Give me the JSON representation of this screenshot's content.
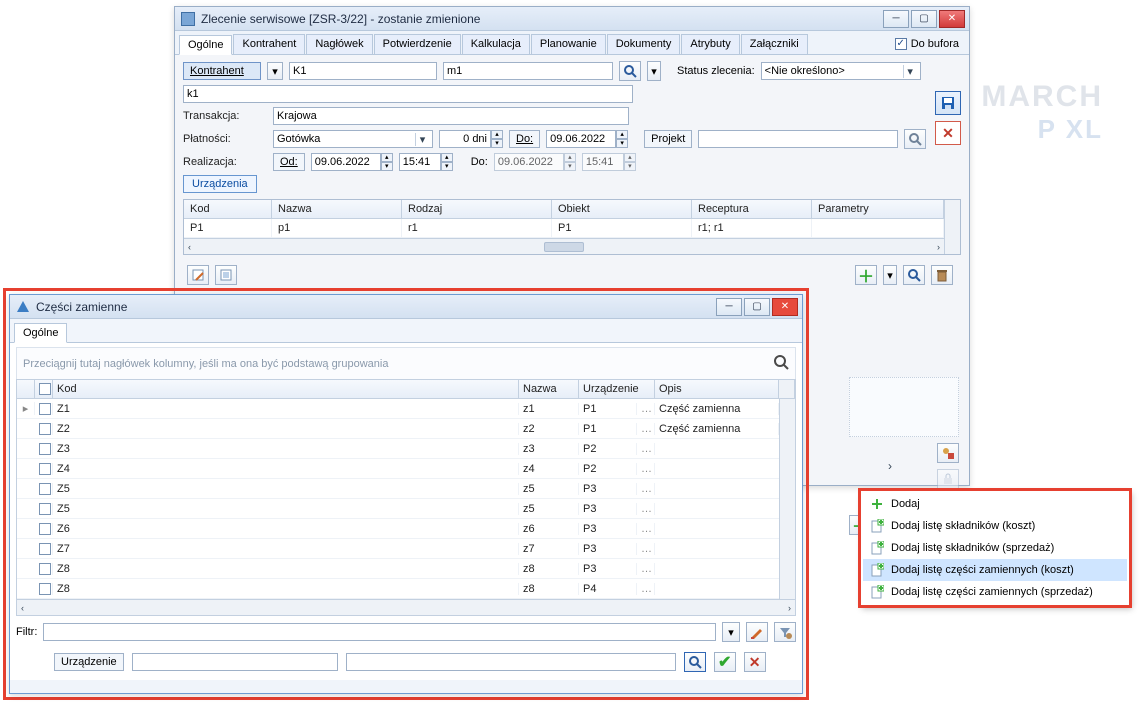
{
  "brand": {
    "l1": "MARCH",
    "l2": "P XL"
  },
  "mainWindow": {
    "title": "Zlecenie serwisowe [ZSR-3/22]  - zostanie zmienione",
    "tabs": [
      "Ogólne",
      "Kontrahent",
      "Nagłówek",
      "Potwierdzenie",
      "Kalkulacja",
      "Planowanie",
      "Dokumenty",
      "Atrybuty",
      "Załączniki"
    ],
    "doBufora": "Do bufora",
    "kontrahentBtn": "Kontrahent",
    "kontrahentCode": "K1",
    "kontrahentName": "m1",
    "kontrahentLower": "k1",
    "transakcjaLbl": "Transakcja:",
    "transakcjaVal": "Krajowa",
    "statusLbl": "Status zlecenia:",
    "statusVal": "<Nie określono>",
    "platnosciLbl": "Płatności:",
    "platnosciVal": "Gotówka",
    "dniVal": "0 dni",
    "doBtn": "Do:",
    "doDate": "09.06.2022",
    "projektBtn": "Projekt",
    "realizacjaLbl": "Realizacja:",
    "odBtn": "Od:",
    "odDate": "09.06.2022",
    "odTime": "15:41",
    "doLbl": "Do:",
    "doDate2": "09.06.2022",
    "doTime": "15:41",
    "urzadzeniaTab": "Urządzenia",
    "gridHeaders": {
      "kod": "Kod",
      "nazwa": "Nazwa",
      "rodzaj": "Rodzaj",
      "obiekt": "Obiekt",
      "receptura": "Receptura",
      "param": "Parametry"
    },
    "gridRow": {
      "kod": "P1",
      "nazwa": "p1",
      "rodzaj": "r1",
      "obiekt": "P1",
      "receptura": "r1; r1"
    }
  },
  "sideIcons": {},
  "contextMenu": {
    "items": [
      "Dodaj",
      "Dodaj listę składników (koszt)",
      "Dodaj listę składników (sprzedaż)",
      "Dodaj listę części zamiennych (koszt)",
      "Dodaj listę części zamiennych (sprzedaż)"
    ],
    "selectedIndex": 3
  },
  "partsWindow": {
    "title": "Części zamienne",
    "tab": "Ogólne",
    "groupHint": "Przeciągnij tutaj nagłówek kolumny, jeśli ma ona być podstawą grupowania",
    "headers": {
      "chk": "",
      "kod": "Kod",
      "nazwa": "Nazwa",
      "urz": "Urządzenie",
      "opis": "Opis"
    },
    "rows": [
      {
        "kod": "Z1",
        "nazwa": "z1",
        "urz": "P1",
        "opis": "Część zamienna"
      },
      {
        "kod": "Z2",
        "nazwa": "z2",
        "urz": "P1",
        "opis": "Część zamienna"
      },
      {
        "kod": "Z3",
        "nazwa": "z3",
        "urz": "P2",
        "opis": ""
      },
      {
        "kod": "Z4",
        "nazwa": "z4",
        "urz": "P2",
        "opis": ""
      },
      {
        "kod": "Z5",
        "nazwa": "z5",
        "urz": "P3",
        "opis": ""
      },
      {
        "kod": "Z5",
        "nazwa": "z5",
        "urz": "P3",
        "opis": ""
      },
      {
        "kod": "Z6",
        "nazwa": "z6",
        "urz": "P3",
        "opis": ""
      },
      {
        "kod": "Z7",
        "nazwa": "z7",
        "urz": "P3",
        "opis": ""
      },
      {
        "kod": "Z8",
        "nazwa": "z8",
        "urz": "P3",
        "opis": ""
      },
      {
        "kod": "Z8",
        "nazwa": "z8",
        "urz": "P4",
        "opis": ""
      }
    ],
    "filtrLbl": "Filtr:",
    "urzadzenieBtn": "Urządzenie"
  }
}
